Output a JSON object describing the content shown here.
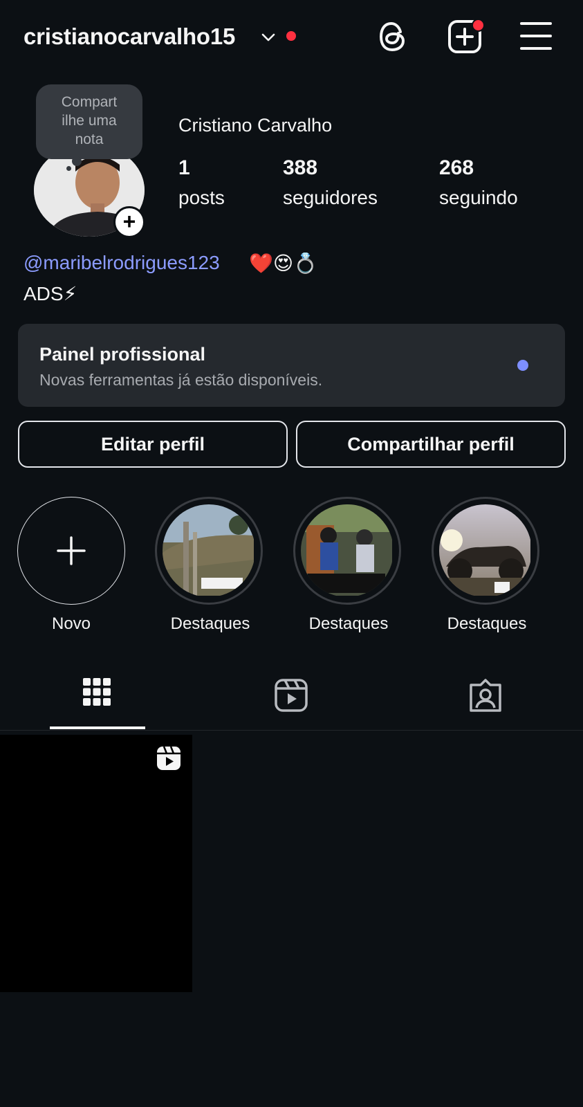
{
  "header": {
    "username": "cristianocarvalho15",
    "icons": [
      "chevron-down-icon",
      "threads-icon",
      "new-post-icon",
      "menu-icon"
    ]
  },
  "profile": {
    "note_lines": [
      "Compart",
      "ilhe uma",
      "nota"
    ],
    "full_name": "Cristiano Carvalho",
    "stats": [
      {
        "value": "1",
        "label": "posts"
      },
      {
        "value": "388",
        "label": "seguidores"
      },
      {
        "value": "268",
        "label": "seguindo"
      }
    ],
    "bio_mention": "@maribelrodrigues123",
    "bio_emoji": "❤️😍💍",
    "bio_text": "ADS⚡"
  },
  "pro_panel": {
    "title": "Painel profissional",
    "subtitle": "Novas ferramentas já estão disponíveis."
  },
  "buttons": {
    "edit": "Editar perfil",
    "share": "Compartilhar perfil"
  },
  "highlights": [
    {
      "label": "Novo"
    },
    {
      "label": "Destaques"
    },
    {
      "label": "Destaques"
    },
    {
      "label": "Destaques"
    }
  ],
  "tabs": [
    "grid-icon",
    "reels-icon",
    "tagged-icon"
  ],
  "colors": {
    "background": "#0c1014",
    "notification": "#ff3040",
    "mention": "#8c9cff",
    "panel": "#25292e"
  }
}
